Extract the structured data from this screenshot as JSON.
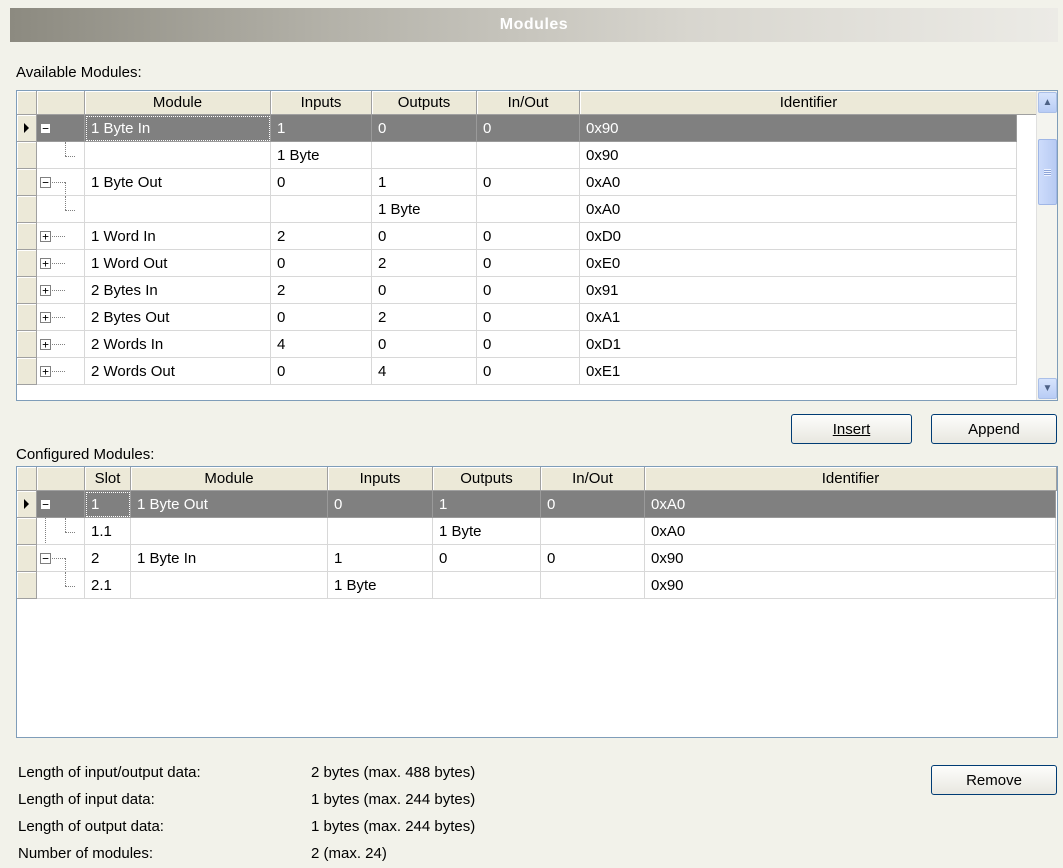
{
  "title": "Modules",
  "available": {
    "label": "Available Modules:",
    "columns": [
      "Module",
      "Inputs",
      "Outputs",
      "In/Out",
      "Identifier"
    ],
    "rows": [
      {
        "module": "1  Byte In",
        "inputs": "1",
        "outputs": "0",
        "inout": "0",
        "identifier": "0x90"
      },
      {
        "module": "",
        "inputs": "1 Byte",
        "outputs": "",
        "inout": "",
        "identifier": "0x90"
      },
      {
        "module": "1  Byte Out",
        "inputs": "0",
        "outputs": "1",
        "inout": "0",
        "identifier": "0xA0"
      },
      {
        "module": "",
        "inputs": "",
        "outputs": "1 Byte",
        "inout": "",
        "identifier": "0xA0"
      },
      {
        "module": "1  Word In",
        "inputs": "2",
        "outputs": "0",
        "inout": "0",
        "identifier": "0xD0"
      },
      {
        "module": "1  Word Out",
        "inputs": "0",
        "outputs": "2",
        "inout": "0",
        "identifier": "0xE0"
      },
      {
        "module": "2  Bytes In",
        "inputs": "2",
        "outputs": "0",
        "inout": "0",
        "identifier": "0x91"
      },
      {
        "module": "2  Bytes Out",
        "inputs": "0",
        "outputs": "2",
        "inout": "0",
        "identifier": "0xA1"
      },
      {
        "module": "2  Words In",
        "inputs": "4",
        "outputs": "0",
        "inout": "0",
        "identifier": "0xD1"
      },
      {
        "module": "2  Words Out",
        "inputs": "0",
        "outputs": "4",
        "inout": "0",
        "identifier": "0xE1"
      }
    ]
  },
  "buttons": {
    "insert": "Insert",
    "append": "Append",
    "remove": "Remove"
  },
  "configured": {
    "label": "Configured Modules:",
    "columns": [
      "Slot",
      "Module",
      "Inputs",
      "Outputs",
      "In/Out",
      "Identifier"
    ],
    "rows": [
      {
        "slot": "1",
        "module": "1  Byte Out",
        "inputs": "0",
        "outputs": "1",
        "inout": "0",
        "identifier": "0xA0"
      },
      {
        "slot": "1.1",
        "module": "",
        "inputs": "",
        "outputs": "1 Byte",
        "inout": "",
        "identifier": "0xA0"
      },
      {
        "slot": "2",
        "module": "1  Byte In",
        "inputs": "1",
        "outputs": "0",
        "inout": "0",
        "identifier": "0x90"
      },
      {
        "slot": "2.1",
        "module": "",
        "inputs": "1 Byte",
        "outputs": "",
        "inout": "",
        "identifier": "0x90"
      }
    ]
  },
  "stats": [
    {
      "label": "Length of input/output data:",
      "value": "2 bytes (max. 488 bytes)"
    },
    {
      "label": "Length of input data:",
      "value": "1 bytes (max. 244 bytes)"
    },
    {
      "label": "Length of output data:",
      "value": "1 bytes (max. 244 bytes)"
    },
    {
      "label": "Number of modules:",
      "value": "2 (max. 24)"
    }
  ]
}
